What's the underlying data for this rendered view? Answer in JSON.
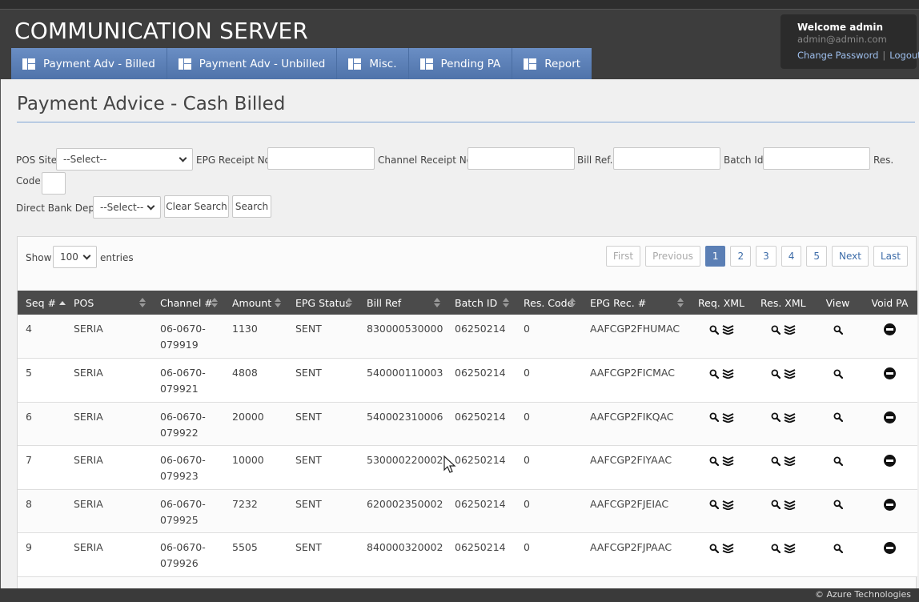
{
  "app": {
    "title": "COMMUNICATION SERVER"
  },
  "nav": [
    {
      "label": "Payment Adv - Billed"
    },
    {
      "label": "Payment Adv - Unbilled"
    },
    {
      "label": "Misc."
    },
    {
      "label": "Pending PA"
    },
    {
      "label": "Report"
    }
  ],
  "user": {
    "welcome": "Welcome admin",
    "email": "admin@admin.com",
    "change_password": "Change Password",
    "logout": "Logout"
  },
  "page": {
    "title": "Payment Advice - Cash Billed"
  },
  "filters": {
    "pos_site_label": "POS Site",
    "pos_site_value": "--Select--",
    "epg_receipt_label": "EPG Receipt No",
    "epg_receipt_value": "",
    "channel_receipt_label": "Channel Receipt No",
    "channel_receipt_value": "",
    "bill_ref_label": "Bill Ref.",
    "bill_ref_value": "",
    "batch_id_label": "Batch Id",
    "batch_id_value": "",
    "res_label": "Res.",
    "code_label": "Code",
    "res_code_value": "",
    "direct_bank_label": "Direct Bank Dep.",
    "direct_bank_value": "--Select--",
    "clear_search": "Clear Search",
    "search": "Search"
  },
  "table_controls": {
    "show_label": "Show",
    "entries_value": "100",
    "entries_label": "entries",
    "pager": {
      "first": "First",
      "previous": "Previous",
      "pages": [
        "1",
        "2",
        "3",
        "4",
        "5"
      ],
      "active_page": "1",
      "next": "Next",
      "last": "Last"
    }
  },
  "columns": [
    "Seq #",
    "POS",
    "Channel #",
    "Amount",
    "EPG Status",
    "Bill Ref",
    "Batch ID",
    "Res. Code",
    "EPG Rec. #",
    "Req. XML",
    "Res. XML",
    "View",
    "Void PA"
  ],
  "rows": [
    {
      "seq": "4",
      "pos": "SERIA",
      "channel_a": "06-0670-",
      "channel_b": "079919",
      "amount": "1130",
      "status": "SENT",
      "bill_ref": "830000530000",
      "batch_id": "06250214",
      "res_code": "0",
      "epg_rec": "AAFCGP2FHUMAC"
    },
    {
      "seq": "5",
      "pos": "SERIA",
      "channel_a": "06-0670-",
      "channel_b": "079921",
      "amount": "4808",
      "status": "SENT",
      "bill_ref": "540000110003",
      "batch_id": "06250214",
      "res_code": "0",
      "epg_rec": "AAFCGP2FICMAC"
    },
    {
      "seq": "6",
      "pos": "SERIA",
      "channel_a": "06-0670-",
      "channel_b": "079922",
      "amount": "20000",
      "status": "SENT",
      "bill_ref": "540002310006",
      "batch_id": "06250214",
      "res_code": "0",
      "epg_rec": "AAFCGP2FIKQAC"
    },
    {
      "seq": "7",
      "pos": "SERIA",
      "channel_a": "06-0670-",
      "channel_b": "079923",
      "amount": "10000",
      "status": "SENT",
      "bill_ref": "530000220002",
      "batch_id": "06250214",
      "res_code": "0",
      "epg_rec": "AAFCGP2FIYAAC"
    },
    {
      "seq": "8",
      "pos": "SERIA",
      "channel_a": "06-0670-",
      "channel_b": "079925",
      "amount": "7232",
      "status": "SENT",
      "bill_ref": "620002350002",
      "batch_id": "06250214",
      "res_code": "0",
      "epg_rec": "AAFCGP2FJEIAC"
    },
    {
      "seq": "9",
      "pos": "SERIA",
      "channel_a": "06-0670-",
      "channel_b": "079926",
      "amount": "5505",
      "status": "SENT",
      "bill_ref": "840000320002",
      "batch_id": "06250214",
      "res_code": "0",
      "epg_rec": "AAFCGP2FJPAAC"
    }
  ],
  "icons": {
    "search": "search-icon",
    "layers": "layers-icon",
    "void": "void-circle-icon"
  },
  "footer": {
    "text": "© Azure Technologies"
  },
  "colors": {
    "nav_blue": "#5b7fb5",
    "header_dark": "#3d3d3d",
    "table_header": "#4b4b4b",
    "link": "#3d6ca8"
  }
}
